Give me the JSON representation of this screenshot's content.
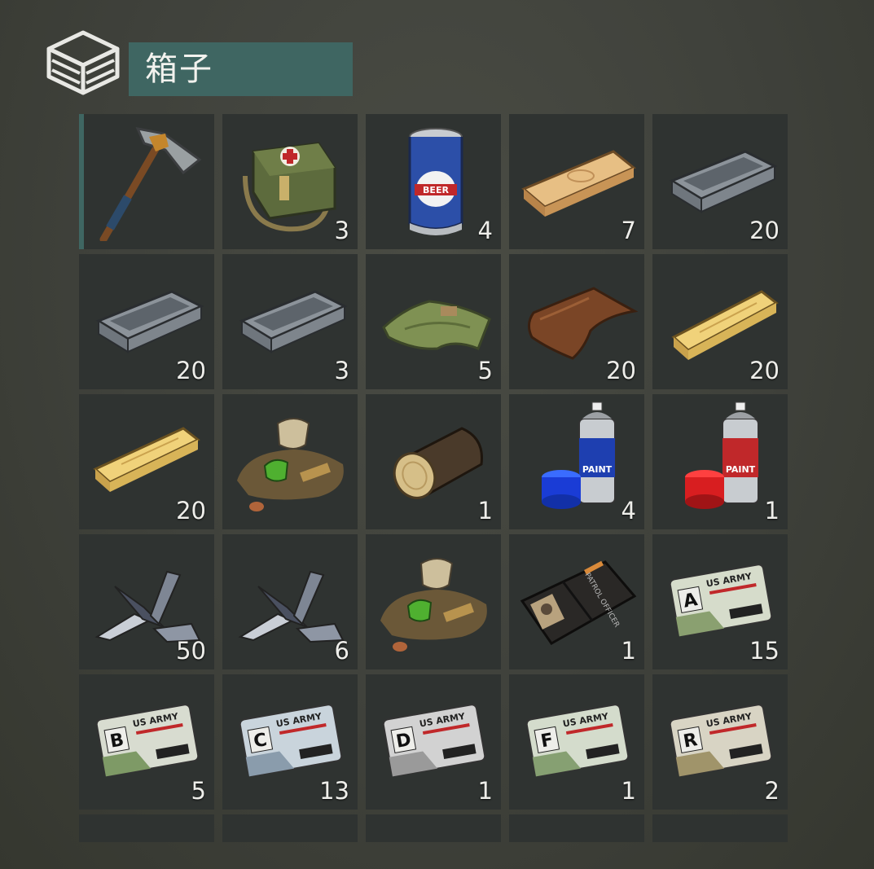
{
  "container": {
    "title": "箱子",
    "icon": "crate-icon"
  },
  "slots": [
    {
      "item": "pickaxe-icon",
      "qty": ""
    },
    {
      "item": "medkit-bag-icon",
      "qty": "3"
    },
    {
      "item": "beer-can-icon",
      "qty": "4",
      "label": "BEER"
    },
    {
      "item": "wooden-plank-icon",
      "qty": "7"
    },
    {
      "item": "iron-ingot-icon",
      "qty": "20"
    },
    {
      "item": "iron-ingot-icon",
      "qty": "20"
    },
    {
      "item": "iron-ingot-icon",
      "qty": "3"
    },
    {
      "item": "cloth-icon",
      "qty": "5"
    },
    {
      "item": "leather-icon",
      "qty": "20"
    },
    {
      "item": "pine-board-icon",
      "qty": "20"
    },
    {
      "item": "pine-board-icon",
      "qty": "20"
    },
    {
      "item": "junk-pile-icon",
      "qty": ""
    },
    {
      "item": "log-icon",
      "qty": "1"
    },
    {
      "item": "blue-spray-paint-icon",
      "qty": "4",
      "label": "PAINT"
    },
    {
      "item": "red-spray-paint-icon",
      "qty": "1",
      "label": "PAINT"
    },
    {
      "item": "scrap-metal-icon",
      "qty": "50"
    },
    {
      "item": "scrap-metal-icon",
      "qty": "6"
    },
    {
      "item": "junk-pile-icon",
      "qty": ""
    },
    {
      "item": "patrol-wallet-icon",
      "qty": "1",
      "label": "PATROL OFFICER"
    },
    {
      "item": "keycard-a-icon",
      "qty": "15",
      "letter": "A",
      "label": "US ARMY"
    },
    {
      "item": "keycard-b-icon",
      "qty": "5",
      "letter": "B",
      "label": "US ARMY"
    },
    {
      "item": "keycard-c-icon",
      "qty": "13",
      "letter": "C",
      "label": "US ARMY"
    },
    {
      "item": "keycard-d-icon",
      "qty": "1",
      "letter": "D",
      "label": "US ARMY"
    },
    {
      "item": "keycard-f-icon",
      "qty": "1",
      "letter": "F",
      "label": "US ARMY"
    },
    {
      "item": "keycard-r-icon",
      "qty": "2",
      "letter": "R",
      "label": "US ARMY"
    }
  ],
  "colors": {
    "accent": "#3f6662",
    "slot": "#2f3331",
    "background": "#40423c"
  }
}
